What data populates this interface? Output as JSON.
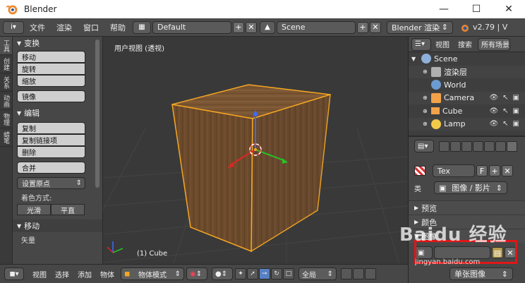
{
  "window": {
    "title": "Blender",
    "minimize": "—",
    "maximize": "☐",
    "close": "✕"
  },
  "infobar": {
    "editor_icon": "i",
    "menus": [
      "文件",
      "渲染",
      "窗口",
      "帮助"
    ],
    "screen_layout": "Default",
    "scene": "Scene",
    "render_engine": "Blender 渲染",
    "version": "v2.79 | V"
  },
  "tool_tabs": [
    "工具",
    "创建",
    "关系",
    "动画",
    "物理",
    "蜡笔"
  ],
  "tool_shelf": {
    "transform_header": "变换",
    "transform_buttons": [
      "移动",
      "旋转",
      "缩放"
    ],
    "mirror_button": "镜像",
    "edit_header": "编辑",
    "edit_buttons": [
      "复制",
      "复制链接项",
      "删除"
    ],
    "join_button": "合并",
    "set_origin": "设置原点",
    "shading_label": "着色方式:",
    "shading_smooth": "光滑",
    "shading_flat": "平直",
    "move_header": "移动",
    "vector_label": "矢量"
  },
  "viewport": {
    "view_label": "用户视图 (透视)",
    "active_object": "(1) Cube",
    "colors": {
      "cube_front": "#6b4a2c",
      "cube_side": "#5a3d24",
      "cube_top": "#7d5835",
      "outline": "#f5a623"
    }
  },
  "viewport_header": {
    "menus": [
      "视图",
      "选择",
      "添加",
      "物体"
    ],
    "mode": "物体模式",
    "pivot_global": "全局"
  },
  "outliner": {
    "view_label": "视图",
    "search_label": "搜索",
    "all_scenes": "所有场景",
    "items": [
      {
        "label": "Scene",
        "icon": "scene-icon",
        "color": "#8fb0d8"
      },
      {
        "label": "渲染层",
        "icon": "render-layer-icon",
        "color": "#b0b0b0"
      },
      {
        "label": "World",
        "icon": "world-icon",
        "color": "#6c9bd1"
      },
      {
        "label": "Camera",
        "icon": "camera-icon",
        "color": "#f2a34a"
      },
      {
        "label": "Cube",
        "icon": "cube-icon",
        "color": "#f2a34a"
      },
      {
        "label": "Lamp",
        "icon": "lamp-icon",
        "color": "#f2c94a"
      }
    ]
  },
  "properties": {
    "texture_name": "Tex",
    "texture_f": "F",
    "type_label": "类",
    "type_value": "图像 / 影片",
    "panels": [
      "预览",
      "颜色",
      "图像"
    ],
    "highlight_color": "#e01616",
    "image_type_value": "单张图像"
  },
  "watermark": {
    "text": "Baidu 经验",
    "url": "jingyan.baidu.com"
  }
}
